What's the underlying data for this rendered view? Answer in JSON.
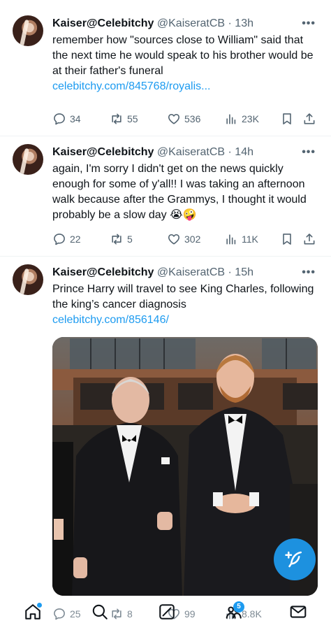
{
  "tweets": [
    {
      "name": "Kaiser@Celebitchy",
      "handle": "@KaiseratCB",
      "time": "13h",
      "text": "remember how \"sources close to William\" said that the next time he would speak to his brother would be at their father's funeral",
      "link": "celebitchy.com/845768/royalis...",
      "replies": "34",
      "reposts": "55",
      "likes": "536",
      "views": "23K"
    },
    {
      "name": "Kaiser@Celebitchy",
      "handle": "@KaiseratCB",
      "time": "14h",
      "text": "again, I'm sorry I didn't get on the news quickly enough for some of y'all!! I was taking an afternoon walk because after the Grammys, I thought it would probably be a slow day 😭🤪",
      "replies": "22",
      "reposts": "5",
      "likes": "302",
      "views": "11K"
    },
    {
      "name": "Kaiser@Celebitchy",
      "handle": "@KaiseratCB",
      "time": "15h",
      "text": "Prince Harry will travel to see King Charles, following the king’s cancer diagnosis",
      "link": "celebitchy.com/856146/",
      "replies": "25",
      "reposts": "8",
      "likes": "99",
      "views": "8.8K"
    }
  ],
  "separator": "·",
  "more_glyph": "•••",
  "bottom_nav": {
    "notification_badge": "5"
  },
  "colors": {
    "accent": "#1d9bf0",
    "text": "#0f1419",
    "muted": "#536471"
  }
}
